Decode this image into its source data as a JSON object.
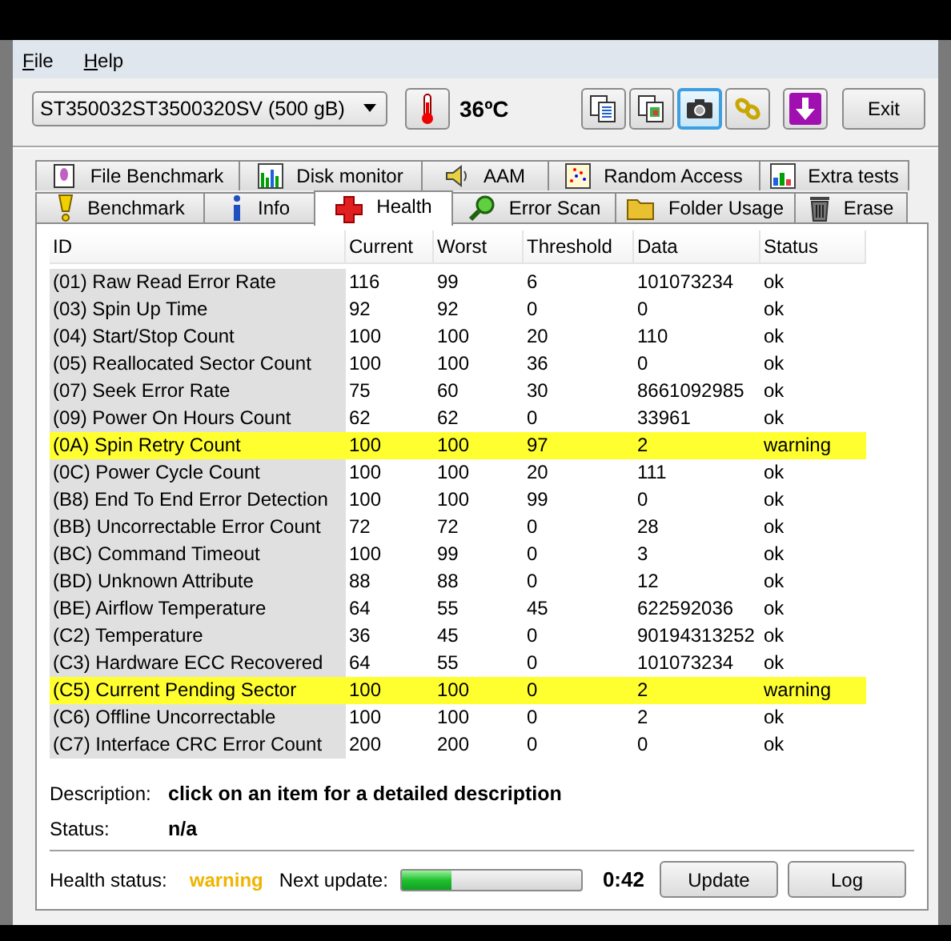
{
  "menu": [
    "File",
    "Help"
  ],
  "toolbar": {
    "drive": "ST350032ST3500320SV (500 gB)",
    "temperature": "36ºC",
    "tools": [
      {
        "kind": "copy-text",
        "selected": false
      },
      {
        "kind": "copy-image",
        "selected": false
      },
      {
        "kind": "camera",
        "selected": true
      },
      {
        "kind": "chain",
        "selected": false
      },
      {
        "kind": "download",
        "selected": false
      }
    ],
    "exit": "Exit"
  },
  "tabs": [
    [
      {
        "label": "File Benchmark",
        "kind": "file",
        "selected": false
      },
      {
        "label": "Disk monitor",
        "kind": "monitor",
        "selected": false
      },
      {
        "label": "AAM",
        "kind": "speaker",
        "selected": false
      },
      {
        "label": "Random Access",
        "kind": "scatter",
        "selected": false
      },
      {
        "label": "Extra tests",
        "kind": "grid",
        "selected": false
      }
    ],
    [
      {
        "label": "Benchmark",
        "kind": "bulb",
        "selected": false
      },
      {
        "label": "Info",
        "kind": "info",
        "selected": false
      },
      {
        "label": "Health",
        "kind": "cross",
        "selected": true
      },
      {
        "label": "Error Scan",
        "kind": "magnifier",
        "selected": false
      },
      {
        "label": "Folder Usage",
        "kind": "folder",
        "selected": false
      },
      {
        "label": "Erase",
        "kind": "trash",
        "selected": false
      }
    ]
  ],
  "table": {
    "columns": [
      "ID",
      "Current",
      "Worst",
      "Threshold",
      "Data",
      "Status"
    ],
    "rows": [
      {
        "cells": [
          "(01) Raw Read Error Rate",
          "116",
          "99",
          "6",
          "101073234",
          "ok"
        ],
        "highlighted": false
      },
      {
        "cells": [
          "(03) Spin Up Time",
          "92",
          "92",
          "0",
          "0",
          "ok"
        ],
        "highlighted": false
      },
      {
        "cells": [
          "(04) Start/Stop Count",
          "100",
          "100",
          "20",
          "110",
          "ok"
        ],
        "highlighted": false
      },
      {
        "cells": [
          "(05) Reallocated Sector Count",
          "100",
          "100",
          "36",
          "0",
          "ok"
        ],
        "highlighted": false
      },
      {
        "cells": [
          "(07) Seek Error Rate",
          "75",
          "60",
          "30",
          "8661092985",
          "ok"
        ],
        "highlighted": false
      },
      {
        "cells": [
          "(09) Power On Hours Count",
          "62",
          "62",
          "0",
          "33961",
          "ok"
        ],
        "highlighted": false
      },
      {
        "cells": [
          "(0A) Spin Retry Count",
          "100",
          "100",
          "97",
          "2",
          "warning"
        ],
        "highlighted": true
      },
      {
        "cells": [
          "(0C) Power Cycle Count",
          "100",
          "100",
          "20",
          "111",
          "ok"
        ],
        "highlighted": false
      },
      {
        "cells": [
          "(B8) End To End Error Detection",
          "100",
          "100",
          "99",
          "0",
          "ok"
        ],
        "highlighted": false
      },
      {
        "cells": [
          "(BB) Uncorrectable Error Count",
          "72",
          "72",
          "0",
          "28",
          "ok"
        ],
        "highlighted": false
      },
      {
        "cells": [
          "(BC) Command Timeout",
          "100",
          "99",
          "0",
          "3",
          "ok"
        ],
        "highlighted": false
      },
      {
        "cells": [
          "(BD) Unknown Attribute",
          "88",
          "88",
          "0",
          "12",
          "ok"
        ],
        "highlighted": false
      },
      {
        "cells": [
          "(BE) Airflow Temperature",
          "64",
          "55",
          "45",
          "622592036",
          "ok"
        ],
        "highlighted": false
      },
      {
        "cells": [
          "(C2) Temperature",
          "36",
          "45",
          "0",
          "90194313252",
          "ok"
        ],
        "highlighted": false
      },
      {
        "cells": [
          "(C3) Hardware ECC Recovered",
          "64",
          "55",
          "0",
          "101073234",
          "ok"
        ],
        "highlighted": false
      },
      {
        "cells": [
          "(C5) Current Pending Sector",
          "100",
          "100",
          "0",
          "2",
          "warning"
        ],
        "highlighted": true
      },
      {
        "cells": [
          "(C6) Offline Uncorrectable",
          "100",
          "100",
          "0",
          "2",
          "ok"
        ],
        "highlighted": false
      },
      {
        "cells": [
          "(C7) Interface CRC Error Count",
          "200",
          "200",
          "0",
          "0",
          "ok"
        ],
        "highlighted": false
      }
    ]
  },
  "details": [
    {
      "label": "Description:",
      "value": "click on an item for a detailed description"
    },
    {
      "label": "Status:",
      "value": "n/a"
    }
  ],
  "footer": {
    "health": {
      "label": "Health status:",
      "value": "warning",
      "kind": "warning"
    },
    "next_label": "Next update:",
    "progress": {
      "level": 0.27
    },
    "countdown": "0:42",
    "buttons": [
      "Update",
      "Log"
    ]
  }
}
